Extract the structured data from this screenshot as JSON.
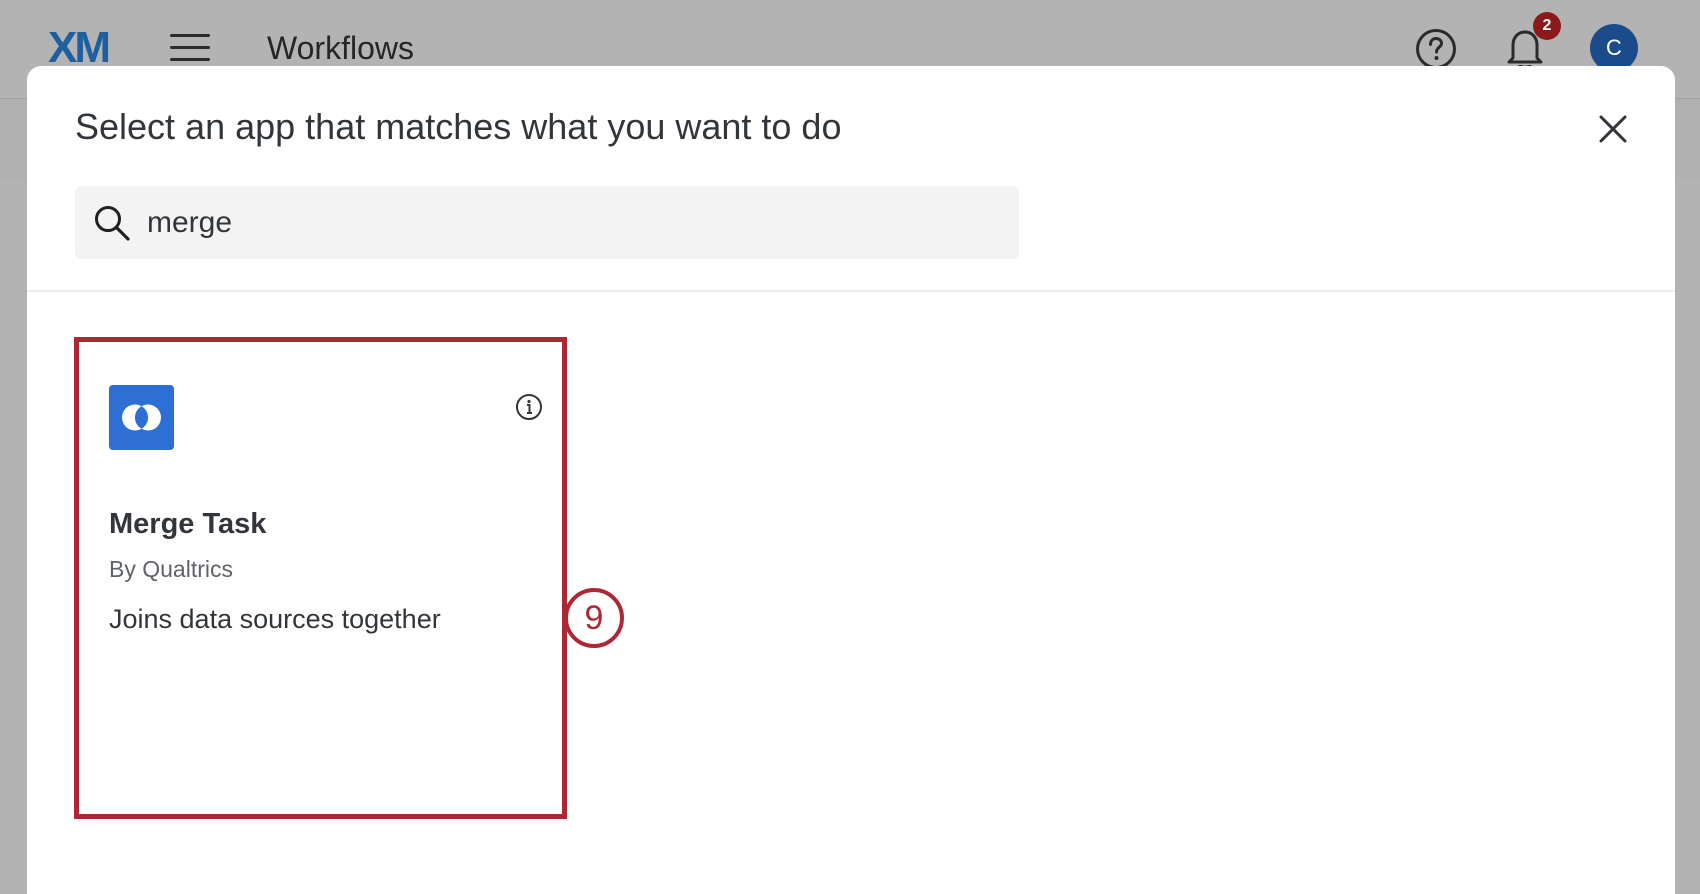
{
  "header": {
    "logo": "XM",
    "title": "Workflows",
    "notification_count": "2",
    "avatar_initial": "C"
  },
  "modal": {
    "title": "Select an app that matches what you want to do",
    "search": {
      "value": "merge",
      "placeholder": ""
    },
    "results": [
      {
        "name": "Merge Task",
        "vendor": "By Qualtrics",
        "description": "Joins data sources together",
        "icon": "merge-icon"
      }
    ]
  },
  "annotation": {
    "step_number": "9"
  },
  "colors": {
    "brand_blue": "#1e5fa0",
    "app_icon_blue": "#2e6fd6",
    "highlight_red": "#ad2834",
    "badge_red": "#8c1a1a"
  }
}
